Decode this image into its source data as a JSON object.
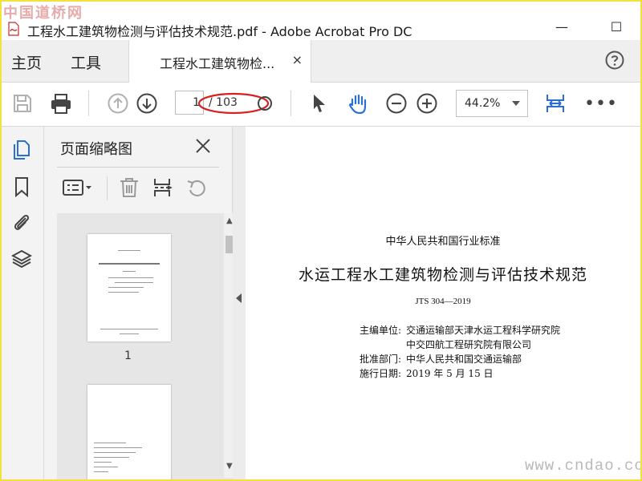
{
  "window": {
    "title": "工程水工建筑物检测与评估技术规范.pdf - Adobe Acrobat Pro DC",
    "minimize": "—",
    "maximize": "☐"
  },
  "watermarks": {
    "top": "中国道桥网",
    "bottom": "www.cndao.com"
  },
  "tabs": {
    "home": "主页",
    "tools": "工具",
    "doc_tab": "工程水工建筑物检...",
    "close": "×"
  },
  "toolbar": {
    "current_page": "1",
    "total_pages": "/ 103",
    "zoom": "44.2%",
    "more": "•••"
  },
  "panel": {
    "title": "页面缩略图",
    "thumb_label": "1"
  },
  "document": {
    "standard_category": "中华人民共和国行业标准",
    "main_title": "水运工程水工建筑物检测与评估技术规范",
    "code": "JTS 304—2019",
    "lines": [
      {
        "label": "主编单位:",
        "value": "交通运输部天津水运工程科学研究院"
      },
      {
        "label": "",
        "value": "中交四航工程研究院有限公司"
      },
      {
        "label": "批准部门:",
        "value": "中华人民共和国交通运输部"
      },
      {
        "label": "施行日期:",
        "value": "2019 年 5 月 15 日"
      }
    ]
  },
  "colors": {
    "accent_blue": "#2a6fd6",
    "annotation_red": "#d82020",
    "frame_yellow": "#f2e23a"
  }
}
